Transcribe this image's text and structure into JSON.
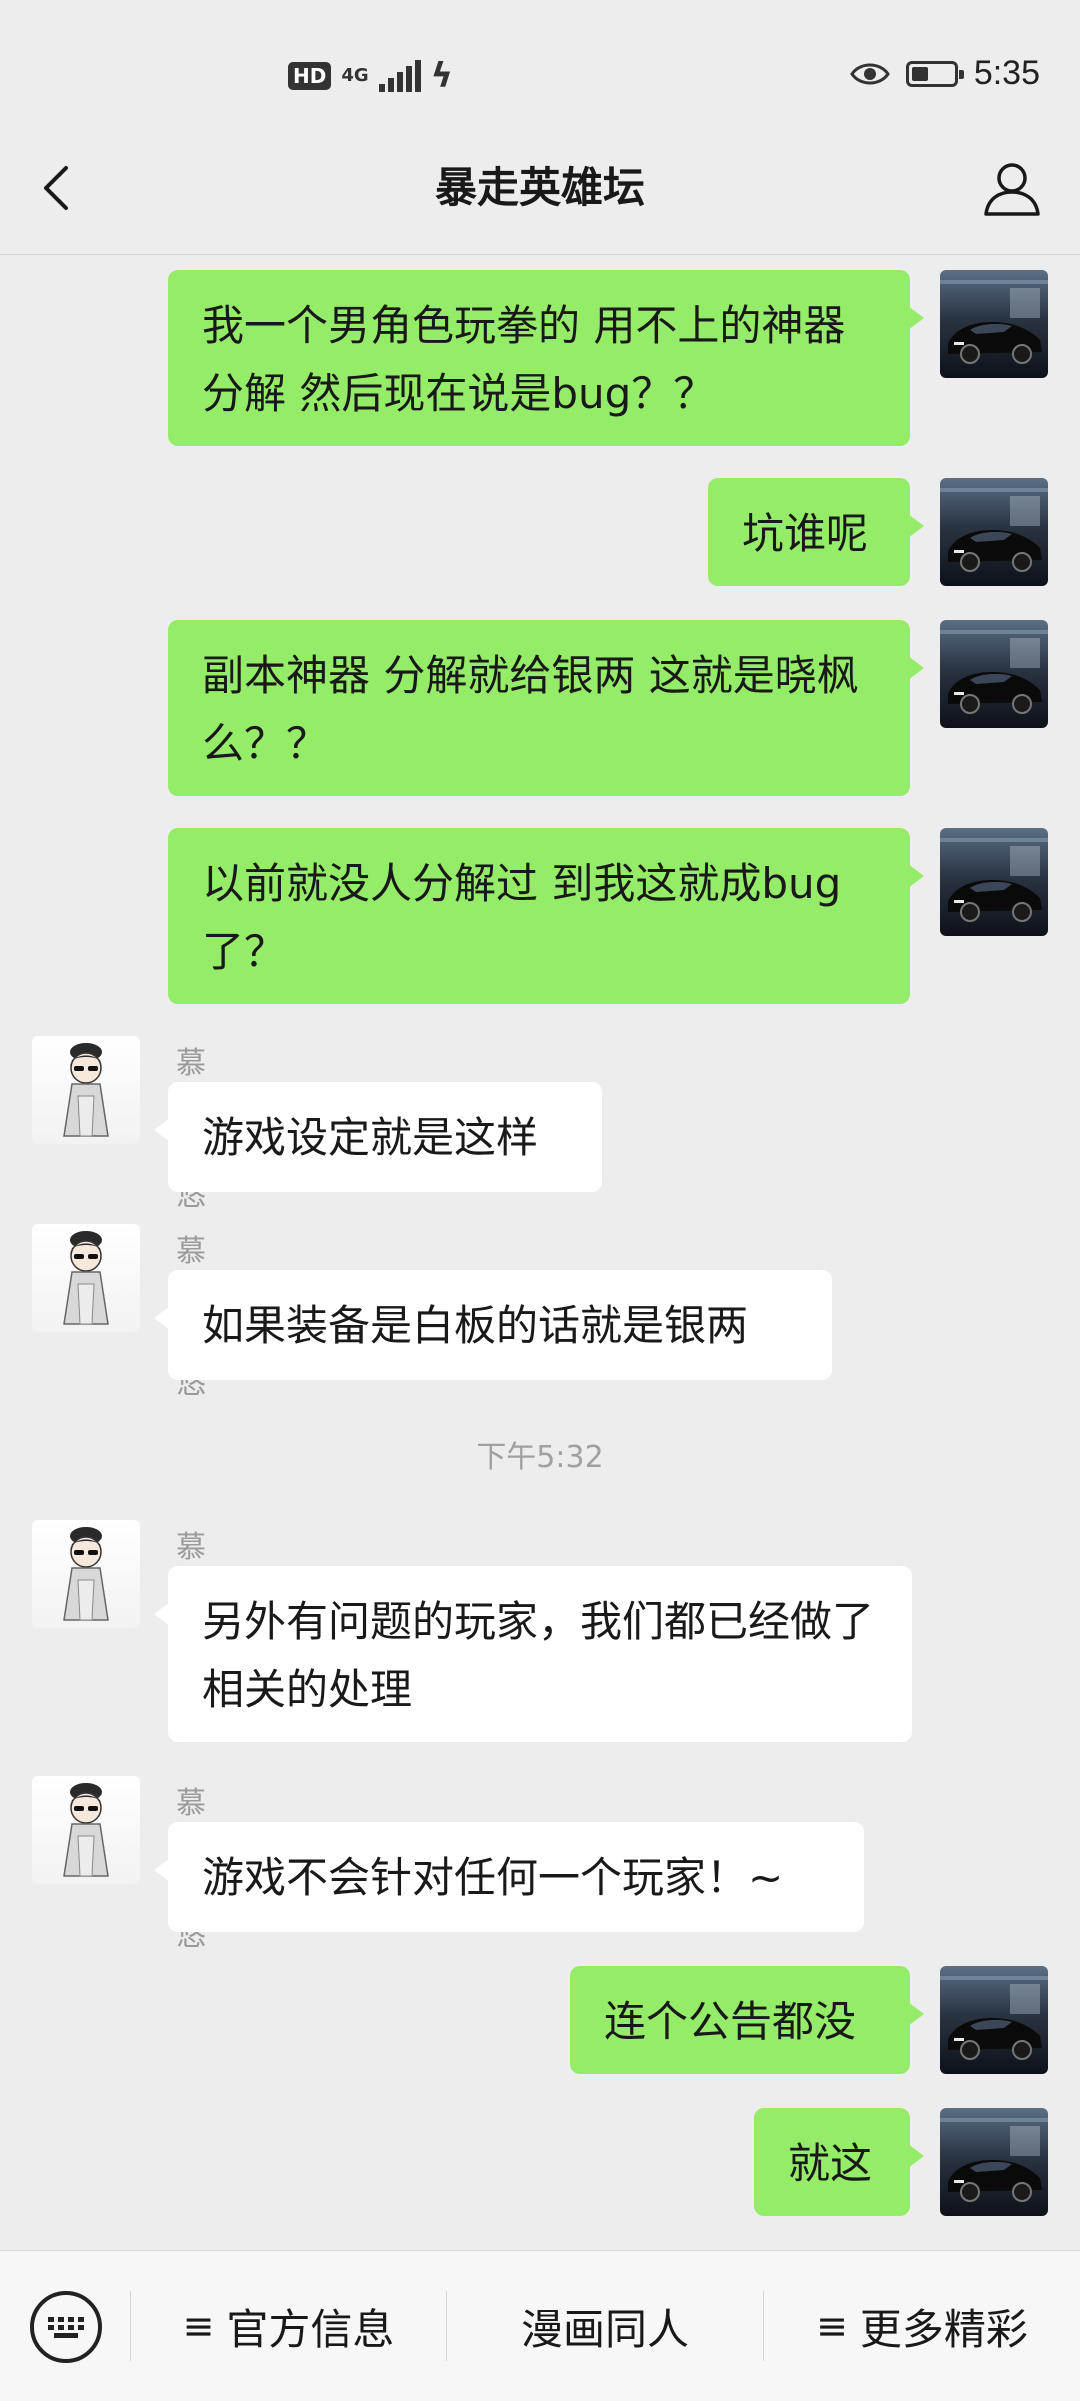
{
  "status_bar": {
    "hd": "HD",
    "network": "4G",
    "time": "5:35",
    "battery_level": 0.4
  },
  "nav": {
    "title": "暴走英雄坛"
  },
  "messages": [
    {
      "side": "out",
      "text": "我一个男角色玩拳的 用不上的神器分解 然后现在说是bug？？"
    },
    {
      "side": "out",
      "text": "坑谁呢"
    },
    {
      "side": "out",
      "text": "副本神器 分解就给银两 这就是晓枫么？？"
    },
    {
      "side": "out",
      "text": "以前就没人分解过 到我这就成bug了？"
    },
    {
      "side": "in",
      "sender": "慕容悠悠",
      "text": "游戏设定就是这样"
    },
    {
      "side": "in",
      "sender": "慕容悠悠",
      "text": "如果装备是白板的话就是银两"
    },
    {
      "side": "in",
      "sender": "慕容悠悠",
      "text": "另外有问题的玩家，我们都已经做了相关的处理"
    },
    {
      "side": "in",
      "sender": "慕容悠悠",
      "text": "游戏不会针对任何一个玩家！~"
    },
    {
      "side": "out",
      "text": "连个公告都没"
    },
    {
      "side": "out",
      "text": "就这"
    }
  ],
  "time_divider": "下午5:32",
  "bottom_menu": {
    "item1": "官方信息",
    "item2": "漫画同人",
    "item3": "更多精彩",
    "menu_glyph": "≡"
  },
  "colors": {
    "outgoing_bubble": "#95ec69",
    "incoming_bubble": "#ffffff",
    "background": "#ededed"
  }
}
